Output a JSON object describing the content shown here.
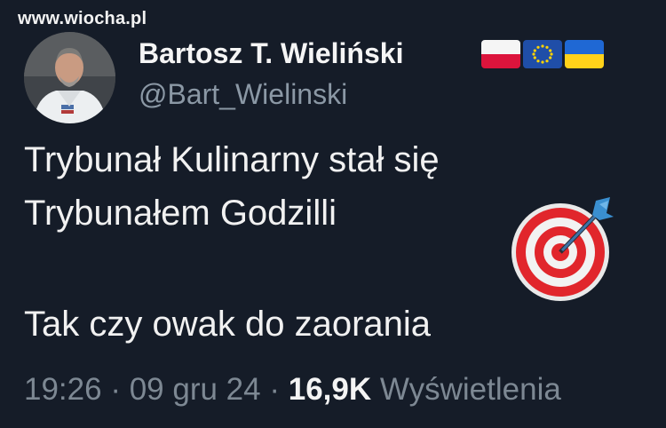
{
  "watermark": "www.wiocha.pl",
  "tweet": {
    "author_name": "Bartosz T. Wieliński",
    "handle": "@Bart_Wielinski",
    "flags": [
      "flag-poland-icon",
      "flag-eu-icon",
      "flag-ukraine-icon"
    ],
    "lines": [
      "Trybunał Kulinarny stał się",
      "Trybunałem Godzilli",
      "Tak czy owak do zaorania"
    ],
    "emoji": "direct-hit-icon",
    "time": "19:26",
    "date": "09 gru 24",
    "separator": "·",
    "views_count": "16,9K",
    "views_label": "Wyświetlenia"
  }
}
